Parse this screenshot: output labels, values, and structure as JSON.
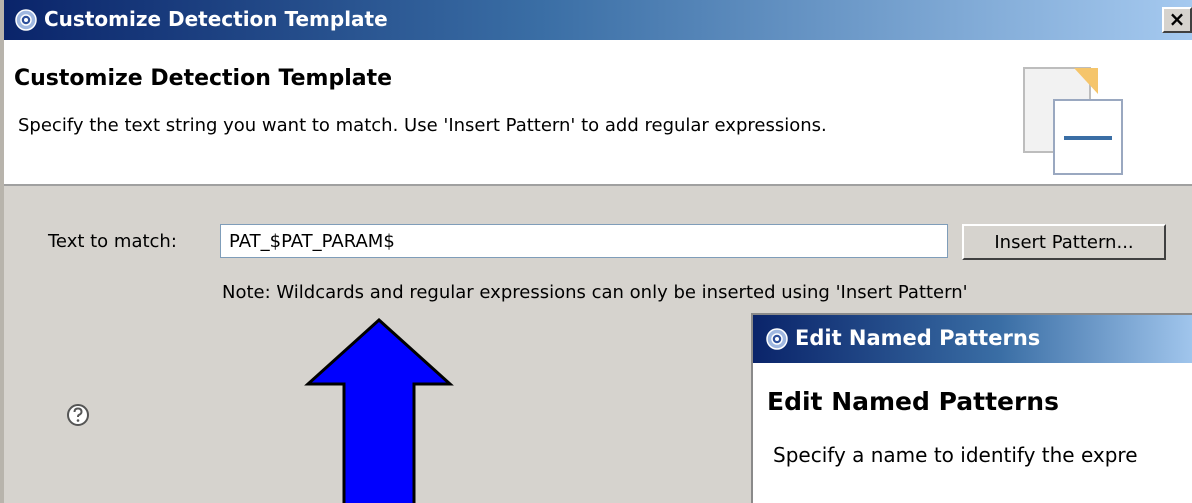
{
  "window": {
    "title": "Customize Detection Template",
    "close_label": "×"
  },
  "header": {
    "title": "Customize Detection Template",
    "description": "Specify the text string you want to match.  Use 'Insert Pattern' to add regular expressions."
  },
  "form": {
    "text_label": "Text to match:",
    "text_value": "PAT_$PAT_PARAM$",
    "insert_button": "Insert Pattern...",
    "note": "Note:  Wildcards and regular expressions can only be inserted using 'Insert Pattern'"
  },
  "sub_dialog": {
    "title": "Edit Named Patterns",
    "heading": "Edit Named Patterns",
    "description": "Specify a name to identify the expre"
  },
  "icons": {
    "title": "gear-icon",
    "help": "help-icon",
    "wizard": "document-wizard-icon"
  },
  "colors": {
    "titlebar_start": "#0a246a",
    "titlebar_end": "#a6caf0",
    "dialog_bg": "#d6d3ce",
    "arrow_fill": "#0000ff"
  }
}
